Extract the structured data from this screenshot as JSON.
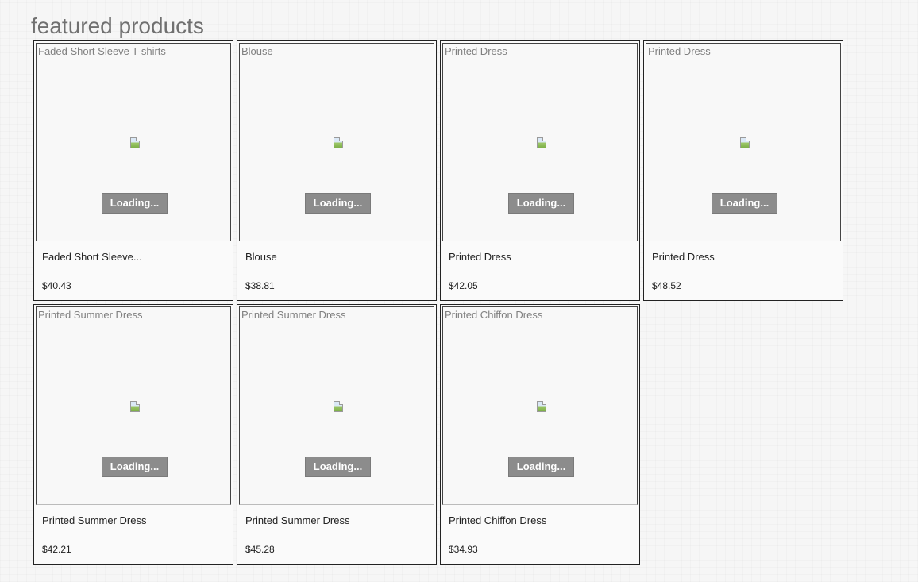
{
  "page": {
    "title": "featured products"
  },
  "products": [
    {
      "image_alt": "Faded Short Sleeve T-shirts",
      "loading_label": "Loading...",
      "name": "Faded Short Sleeve...",
      "price": "$40.43"
    },
    {
      "image_alt": "Blouse",
      "loading_label": "Loading...",
      "name": "Blouse",
      "price": "$38.81"
    },
    {
      "image_alt": "Printed Dress",
      "loading_label": "Loading...",
      "name": "Printed Dress",
      "price": "$42.05"
    },
    {
      "image_alt": "Printed Dress",
      "loading_label": "Loading...",
      "name": "Printed Dress",
      "price": "$48.52"
    },
    {
      "image_alt": "Printed Summer Dress",
      "loading_label": "Loading...",
      "name": "Printed Summer Dress",
      "price": "$42.21"
    },
    {
      "image_alt": "Printed Summer Dress",
      "loading_label": "Loading...",
      "name": "Printed Summer Dress",
      "price": "$45.28"
    },
    {
      "image_alt": "Printed Chiffon Dress",
      "loading_label": "Loading...",
      "name": "Printed Chiffon Dress",
      "price": "$34.93"
    }
  ],
  "colors": {
    "background": "#f6f6f6",
    "title": "#707070",
    "loading_button": "#8c8c8c",
    "card_border": "#222222"
  },
  "icons": {
    "image_placeholder": "broken-image-icon"
  }
}
